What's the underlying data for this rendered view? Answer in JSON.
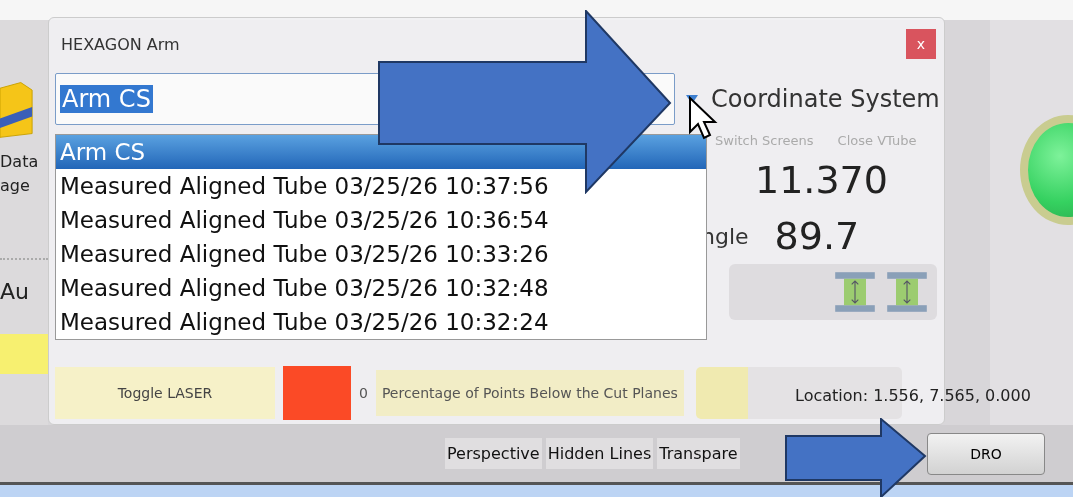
{
  "left_fragments": [
    "Data",
    "age",
    "Au"
  ],
  "dialog": {
    "title": "HEXAGON Arm",
    "close_glyph": "x",
    "combo": {
      "value": "Arm CS",
      "label": "Coordinate System",
      "expanded": true
    },
    "options": [
      {
        "label": "Arm CS",
        "selected": true
      },
      {
        "label": "Measured Aligned Tube 03/25/26 10:37:56",
        "selected": false
      },
      {
        "label": "Measured Aligned Tube 03/25/26 10:36:54",
        "selected": false
      },
      {
        "label": "Measured Aligned Tube 03/25/26 10:33:26",
        "selected": false
      },
      {
        "label": "Measured Aligned Tube 03/25/26 10:32:48",
        "selected": false
      },
      {
        "label": "Measured Aligned Tube 03/25/26 10:32:24",
        "selected": false
      }
    ],
    "ribbon_buttons": [
      "Switch Screens",
      "Close VTube"
    ],
    "readouts": [
      {
        "kind": "boxed",
        "value": "11.370"
      },
      {
        "kind": "labeled",
        "label": "ngle",
        "value": "89.7"
      }
    ],
    "toggle_button": "Toggle LASER",
    "count": "0",
    "percentage_label": "Percentage of Points Below the Cut Planes"
  },
  "location": "Location: 1.556, 7.565, 0.000",
  "view_tabs": [
    "Perspective",
    "Hidden Lines",
    "Transpare"
  ],
  "dro_button": "DRO"
}
